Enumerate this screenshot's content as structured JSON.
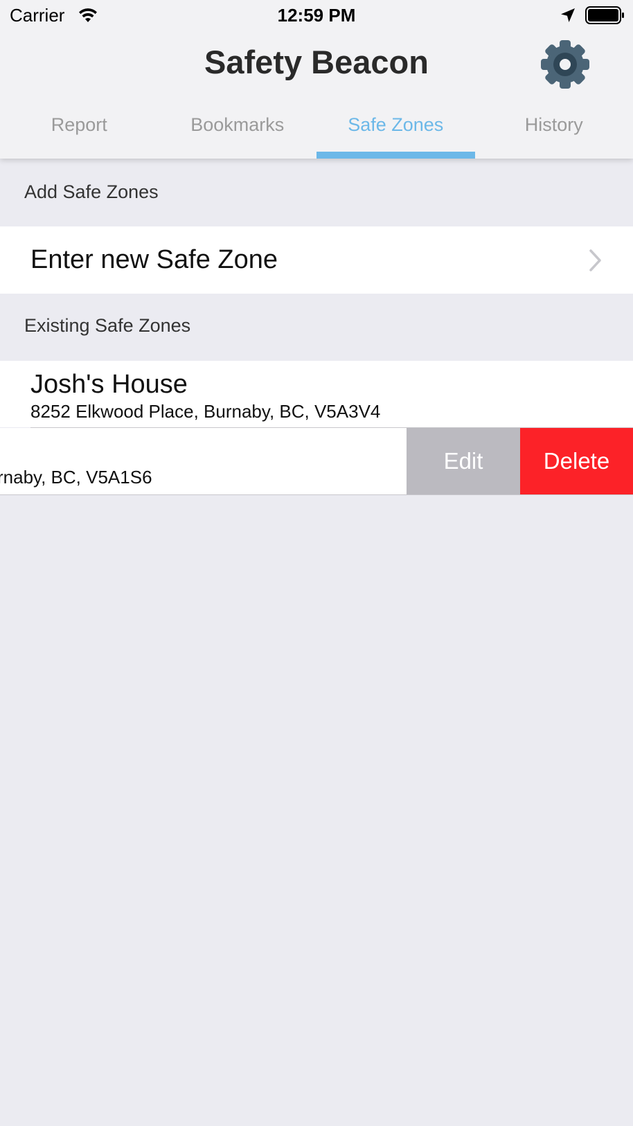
{
  "status_bar": {
    "carrier": "Carrier",
    "time": "12:59 PM",
    "icons": [
      "wifi-icon",
      "location-icon",
      "battery-icon"
    ]
  },
  "header": {
    "title": "Safety Beacon",
    "settings_icon": "gear-icon"
  },
  "tabs": [
    {
      "label": "Report",
      "active": false
    },
    {
      "label": "Bookmarks",
      "active": false
    },
    {
      "label": "Safe Zones",
      "active": true
    },
    {
      "label": "History",
      "active": false
    }
  ],
  "sections": {
    "add": {
      "header": "Add Safe Zones",
      "cell_label": "Enter new Safe Zone"
    },
    "existing": {
      "header": "Existing Safe Zones",
      "zones": [
        {
          "name": "Josh's House",
          "address": "8252 Elkwood Place, Burnaby, BC, V5A3V4"
        },
        {
          "name": "",
          "address": "rnaby, BC, V5A1S6"
        }
      ],
      "swipe_actions": {
        "edit": "Edit",
        "delete": "Delete"
      }
    }
  },
  "colors": {
    "accent": "#6cb8e8",
    "delete": "#fc2228",
    "edit": "#bbbac0",
    "gear": "#4b6577",
    "background": "#ebebf1"
  }
}
